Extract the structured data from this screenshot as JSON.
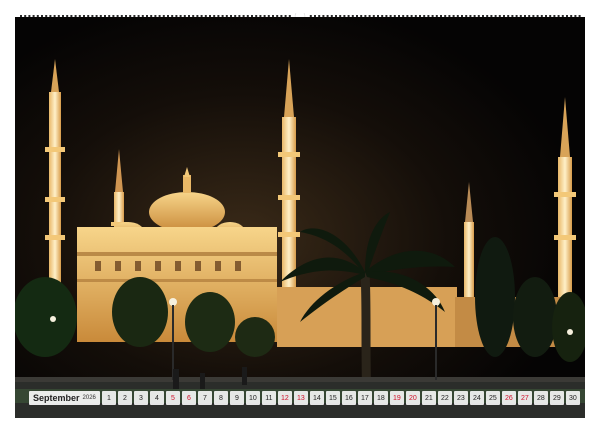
{
  "calendar": {
    "month": "September",
    "year": "2026",
    "days": [
      {
        "n": "1",
        "weekend": false
      },
      {
        "n": "2",
        "weekend": false
      },
      {
        "n": "3",
        "weekend": false
      },
      {
        "n": "4",
        "weekend": false
      },
      {
        "n": "5",
        "weekend": true
      },
      {
        "n": "6",
        "weekend": true
      },
      {
        "n": "7",
        "weekend": false
      },
      {
        "n": "8",
        "weekend": false
      },
      {
        "n": "9",
        "weekend": false
      },
      {
        "n": "10",
        "weekend": false
      },
      {
        "n": "11",
        "weekend": false
      },
      {
        "n": "12",
        "weekend": true
      },
      {
        "n": "13",
        "weekend": true
      },
      {
        "n": "14",
        "weekend": false
      },
      {
        "n": "15",
        "weekend": false
      },
      {
        "n": "16",
        "weekend": false
      },
      {
        "n": "17",
        "weekend": false
      },
      {
        "n": "18",
        "weekend": false
      },
      {
        "n": "19",
        "weekend": true
      },
      {
        "n": "20",
        "weekend": true
      },
      {
        "n": "21",
        "weekend": false
      },
      {
        "n": "22",
        "weekend": false
      },
      {
        "n": "23",
        "weekend": false
      },
      {
        "n": "24",
        "weekend": false
      },
      {
        "n": "25",
        "weekend": false
      },
      {
        "n": "26",
        "weekend": true
      },
      {
        "n": "27",
        "weekend": true
      },
      {
        "n": "28",
        "weekend": false
      },
      {
        "n": "29",
        "weekend": false
      },
      {
        "n": "30",
        "weekend": false
      }
    ]
  },
  "colors": {
    "weekday": "#222222",
    "weekend": "#d0112b",
    "sky": "#050404",
    "floodlight": "#f3c060"
  }
}
